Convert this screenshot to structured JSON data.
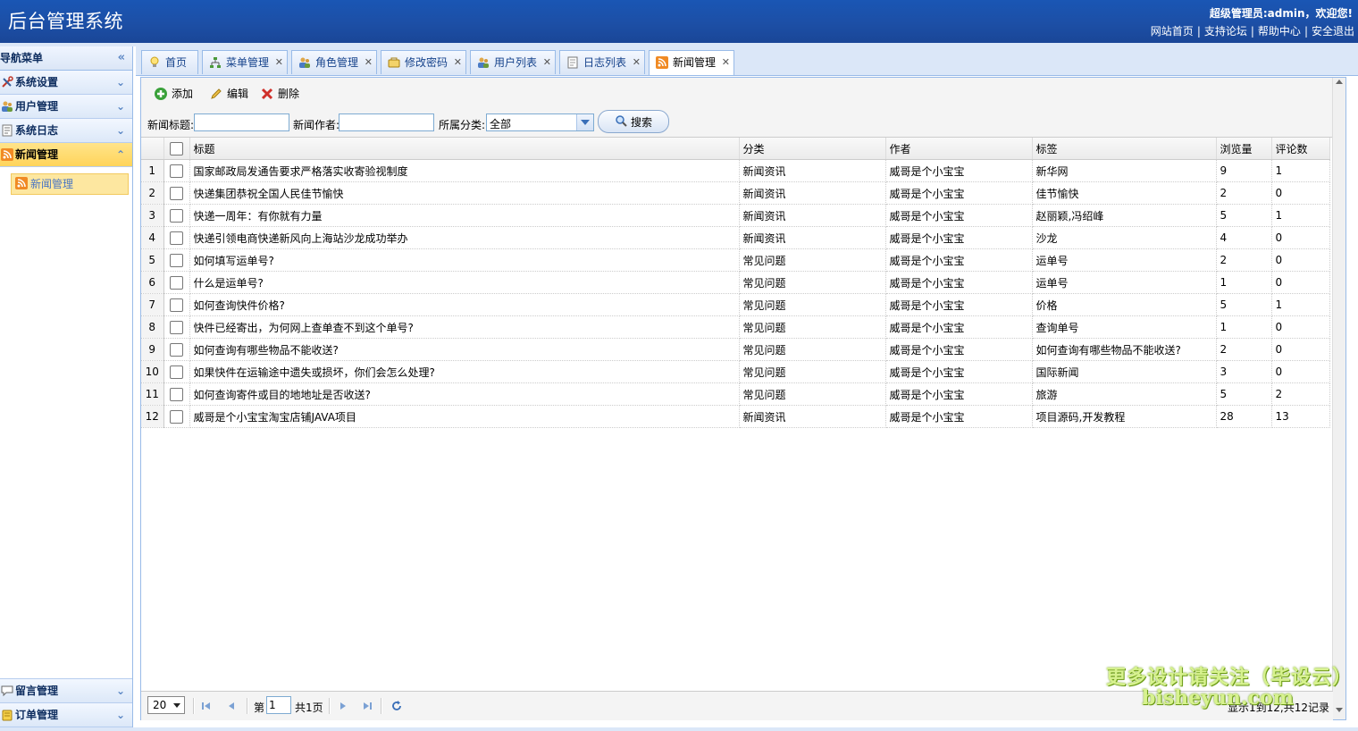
{
  "header": {
    "app_title": "后台管理系统",
    "welcome": "超级管理员:admin，欢迎您!",
    "links": [
      "网站首页",
      "支持论坛",
      "帮助中心",
      "安全退出"
    ]
  },
  "sidebar": {
    "title": "导航菜单",
    "groups": [
      {
        "label": "系统设置",
        "icon": "tools-icon"
      },
      {
        "label": "用户管理",
        "icon": "users-icon"
      },
      {
        "label": "系统日志",
        "icon": "log-icon"
      },
      {
        "label": "新闻管理",
        "icon": "rss-icon",
        "active": true
      }
    ],
    "active_sub_item": "新闻管理",
    "bottom_groups": [
      {
        "label": "留言管理",
        "icon": "comment-icon"
      },
      {
        "label": "订单管理",
        "icon": "order-icon"
      }
    ]
  },
  "tabs": [
    {
      "label": "首页",
      "closable": false
    },
    {
      "label": "菜单管理",
      "closable": true
    },
    {
      "label": "角色管理",
      "closable": true
    },
    {
      "label": "修改密码",
      "closable": true
    },
    {
      "label": "用户列表",
      "closable": true
    },
    {
      "label": "日志列表",
      "closable": true
    },
    {
      "label": "新闻管理",
      "closable": true,
      "active": true
    }
  ],
  "toolbar": {
    "add_label": "添加",
    "edit_label": "编辑",
    "delete_label": "删除"
  },
  "filters": {
    "title_label": "新闻标题:",
    "title_value": "",
    "author_label": "新闻作者:",
    "author_value": "",
    "category_label": "所属分类:",
    "category_value": "全部",
    "search_label": "搜索"
  },
  "grid": {
    "columns": [
      "标题",
      "分类",
      "作者",
      "标签",
      "浏览量",
      "评论数"
    ],
    "rows": [
      {
        "n": "1",
        "title": "国家邮政局发通告要求严格落实收寄验视制度",
        "category": "新闻资讯",
        "author": "威哥是个小宝宝",
        "tags": "新华网",
        "views": "9",
        "comments": "1"
      },
      {
        "n": "2",
        "title": "快递集团恭祝全国人民佳节愉快",
        "category": "新闻资讯",
        "author": "威哥是个小宝宝",
        "tags": "佳节愉快",
        "views": "2",
        "comments": "0"
      },
      {
        "n": "3",
        "title": "快递一周年：有你就有力量",
        "category": "新闻资讯",
        "author": "威哥是个小宝宝",
        "tags": "赵丽颖,冯绍峰",
        "views": "5",
        "comments": "1"
      },
      {
        "n": "4",
        "title": "快递引领电商快递新风向上海站沙龙成功举办",
        "category": "新闻资讯",
        "author": "威哥是个小宝宝",
        "tags": "沙龙",
        "views": "4",
        "comments": "0"
      },
      {
        "n": "5",
        "title": "如何填写运单号?",
        "category": "常见问题",
        "author": "威哥是个小宝宝",
        "tags": "运单号",
        "views": "2",
        "comments": "0"
      },
      {
        "n": "6",
        "title": "什么是运单号?",
        "category": "常见问题",
        "author": "威哥是个小宝宝",
        "tags": "运单号",
        "views": "1",
        "comments": "0"
      },
      {
        "n": "7",
        "title": "如何查询快件价格?",
        "category": "常见问题",
        "author": "威哥是个小宝宝",
        "tags": "价格",
        "views": "5",
        "comments": "1"
      },
      {
        "n": "8",
        "title": "快件已经寄出，为何网上查单查不到这个单号?",
        "category": "常见问题",
        "author": "威哥是个小宝宝",
        "tags": "查询单号",
        "views": "1",
        "comments": "0"
      },
      {
        "n": "9",
        "title": "如何查询有哪些物品不能收送?",
        "category": "常见问题",
        "author": "威哥是个小宝宝",
        "tags": "如何查询有哪些物品不能收送?",
        "views": "2",
        "comments": "0"
      },
      {
        "n": "10",
        "title": "如果快件在运输途中遗失或损坏，你们会怎么处理?",
        "category": "常见问题",
        "author": "威哥是个小宝宝",
        "tags": "国际新闻",
        "views": "3",
        "comments": "0"
      },
      {
        "n": "11",
        "title": "如何查询寄件或目的地地址是否收送?",
        "category": "常见问题",
        "author": "威哥是个小宝宝",
        "tags": "旅游",
        "views": "5",
        "comments": "2"
      },
      {
        "n": "12",
        "title": "威哥是个小宝宝淘宝店铺JAVA项目",
        "category": "新闻资讯",
        "author": "威哥是个小宝宝",
        "tags": "项目源码,开发教程",
        "views": "28",
        "comments": "13"
      }
    ]
  },
  "pager": {
    "page_size": "20",
    "page_prefix": "第",
    "page_value": "1",
    "page_total": "共1页",
    "records": "显示1到12,共12记录"
  },
  "watermark": {
    "line1": "更多设计请关注（毕设云）",
    "line2": "bisheyun.com"
  },
  "colors": {
    "header_blue": "#1c4fa6",
    "active_accordion": "#ffd45a",
    "border_blue": "#99bbe8"
  }
}
